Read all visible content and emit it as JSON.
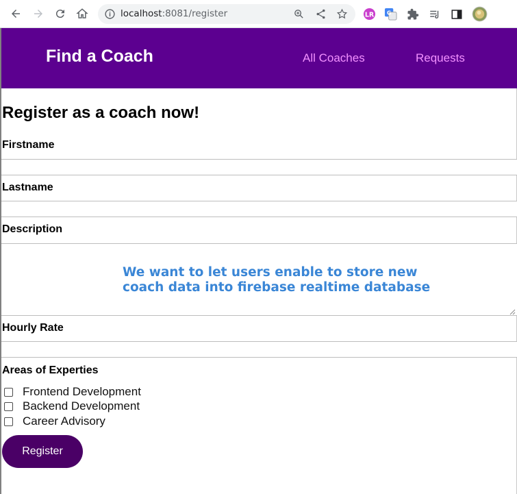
{
  "browser": {
    "url_host": "localhost",
    "url_rest": ":8081/register"
  },
  "app": {
    "brand": "Find a Coach",
    "nav": [
      {
        "label": "All Coaches"
      },
      {
        "label": "Requests"
      }
    ]
  },
  "form": {
    "heading": "Register as a coach now!",
    "firstname_label": "Firstname",
    "firstname_value": "",
    "lastname_label": "Lastname",
    "lastname_value": "",
    "description_label": "Description",
    "description_value": "",
    "hourly_rate_label": "Hourly Rate",
    "hourly_rate_value": "",
    "areas_label": "Areas of Experties",
    "areas": [
      {
        "label": "Frontend Development",
        "checked": false
      },
      {
        "label": "Backend Development",
        "checked": false
      },
      {
        "label": "Career Advisory",
        "checked": false
      }
    ],
    "submit_label": "Register"
  },
  "annotation": {
    "line1": "We want to let users enable to store new",
    "line2": "coach data into firebase realtime database"
  },
  "colors": {
    "header_bg": "#5c0090",
    "nav_link": "#f291ff",
    "button_bg": "#4a0066",
    "annotation": "#3a86d6"
  },
  "icons": [
    "back-arrow-icon",
    "forward-arrow-icon",
    "reload-icon",
    "home-icon",
    "info-icon",
    "zoom-icon",
    "share-icon",
    "star-icon",
    "extension-icon",
    "translate-icon",
    "puzzle-icon",
    "reading-list-icon",
    "side-panel-icon",
    "profile-avatar"
  ]
}
